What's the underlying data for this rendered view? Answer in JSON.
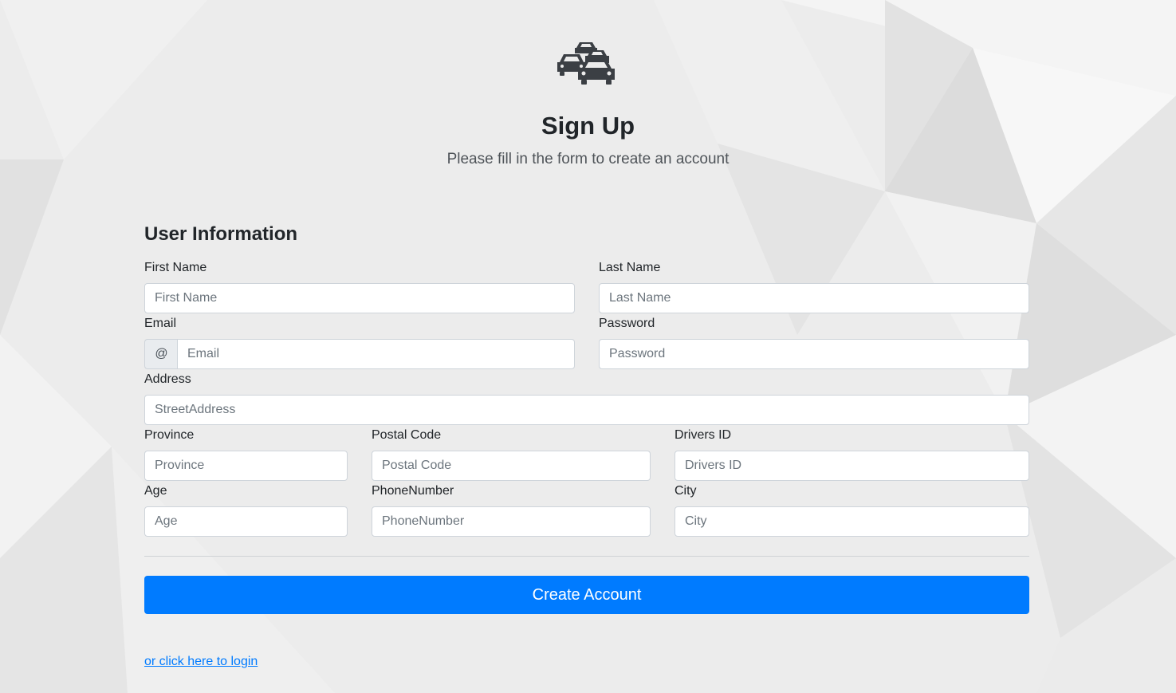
{
  "header": {
    "logo_icon": "cars-traffic-icon",
    "title": "Sign Up",
    "subtitle": "Please fill in the form to create an account"
  },
  "form": {
    "section_title": "User Information",
    "first_name": {
      "label": "First Name",
      "placeholder": "First Name",
      "value": ""
    },
    "last_name": {
      "label": "Last Name",
      "placeholder": "Last Name",
      "value": ""
    },
    "email": {
      "label": "Email",
      "addon": "@",
      "placeholder": "Email",
      "value": ""
    },
    "password": {
      "label": "Password",
      "placeholder": "Password",
      "value": ""
    },
    "address": {
      "label": "Address",
      "placeholder": "StreetAddress",
      "value": ""
    },
    "province": {
      "label": "Province",
      "placeholder": "Province",
      "value": ""
    },
    "postal_code": {
      "label": "Postal Code",
      "placeholder": "Postal Code",
      "value": ""
    },
    "drivers_id": {
      "label": "Drivers ID",
      "placeholder": "Drivers ID",
      "value": ""
    },
    "age": {
      "label": "Age",
      "placeholder": "Age",
      "value": ""
    },
    "phone_number": {
      "label": "PhoneNumber",
      "placeholder": "PhoneNumber",
      "value": ""
    },
    "city": {
      "label": "City",
      "placeholder": "City",
      "value": ""
    },
    "submit_label": "Create Account",
    "login_link": "or click here to login"
  },
  "colors": {
    "primary": "#007bff",
    "background": "#ececec",
    "text": "#212529",
    "border": "#ced4da"
  }
}
